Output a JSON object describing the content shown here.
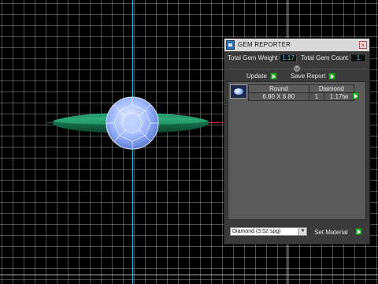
{
  "panel": {
    "title": "GEM REPORTER",
    "total_gem_weight_label": "Total Gem Weight",
    "total_gem_weight_value": "1.17",
    "total_gem_count_label": "Total Gem Count",
    "total_gem_count_value": "1",
    "update_label": "Update",
    "save_report_label": "Save Report",
    "table": {
      "headers": [
        "Round",
        "Diamond"
      ],
      "row": {
        "size": "6.80 X 6.80",
        "count": "1",
        "weight": "1.17tw"
      }
    },
    "material_value": "Diamond   (3.52 spg)",
    "set_material_label": "Set Material"
  },
  "colors": {
    "gem_blue": "#8fb0ff",
    "band_green": "#1f8f62",
    "value_cyan": "#34d0e8",
    "go_green": "#2fa82f"
  }
}
